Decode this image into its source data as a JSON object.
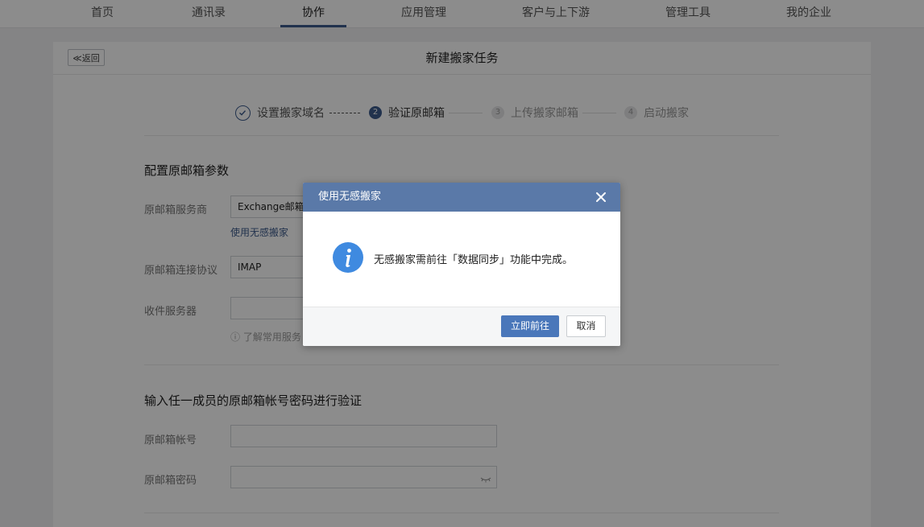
{
  "nav": {
    "items": [
      "首页",
      "通讯录",
      "协作",
      "应用管理",
      "客户与上下游",
      "管理工具",
      "我的企业"
    ],
    "active": "协作"
  },
  "panel": {
    "back_label": "≪返回",
    "title": "新建搬家任务"
  },
  "stepper": {
    "steps": [
      {
        "num": "",
        "label": "设置搬家域名",
        "state": "done"
      },
      {
        "num": "2",
        "label": "验证原邮箱",
        "state": "current"
      },
      {
        "num": "3",
        "label": "上传搬家邮箱",
        "state": "pending"
      },
      {
        "num": "4",
        "label": "启动搬家",
        "state": "pending"
      }
    ]
  },
  "config": {
    "section_title": "配置原邮箱参数",
    "provider_label": "原邮箱服务商",
    "provider_value": "Exchange邮箱",
    "seamless_link": "使用无感搬家",
    "protocol_label": "原邮箱连接协议",
    "protocol_value": "IMAP",
    "server_label": "收件服务器",
    "server_value": "",
    "server_hint": "了解常用服务"
  },
  "verify": {
    "section_title": "输入任一成员的原邮箱帐号密码进行验证",
    "account_label": "原邮箱帐号",
    "account_value": "",
    "password_label": "原邮箱密码",
    "password_value": ""
  },
  "modal": {
    "title": "使用无感搬家",
    "message": "无感搬家需前往「数据同步」功能中完成。",
    "confirm_label": "立即前往",
    "cancel_label": "取消",
    "icon": "info-icon",
    "header_color": "#5a79a8",
    "primary_color": "#4a77ba"
  }
}
